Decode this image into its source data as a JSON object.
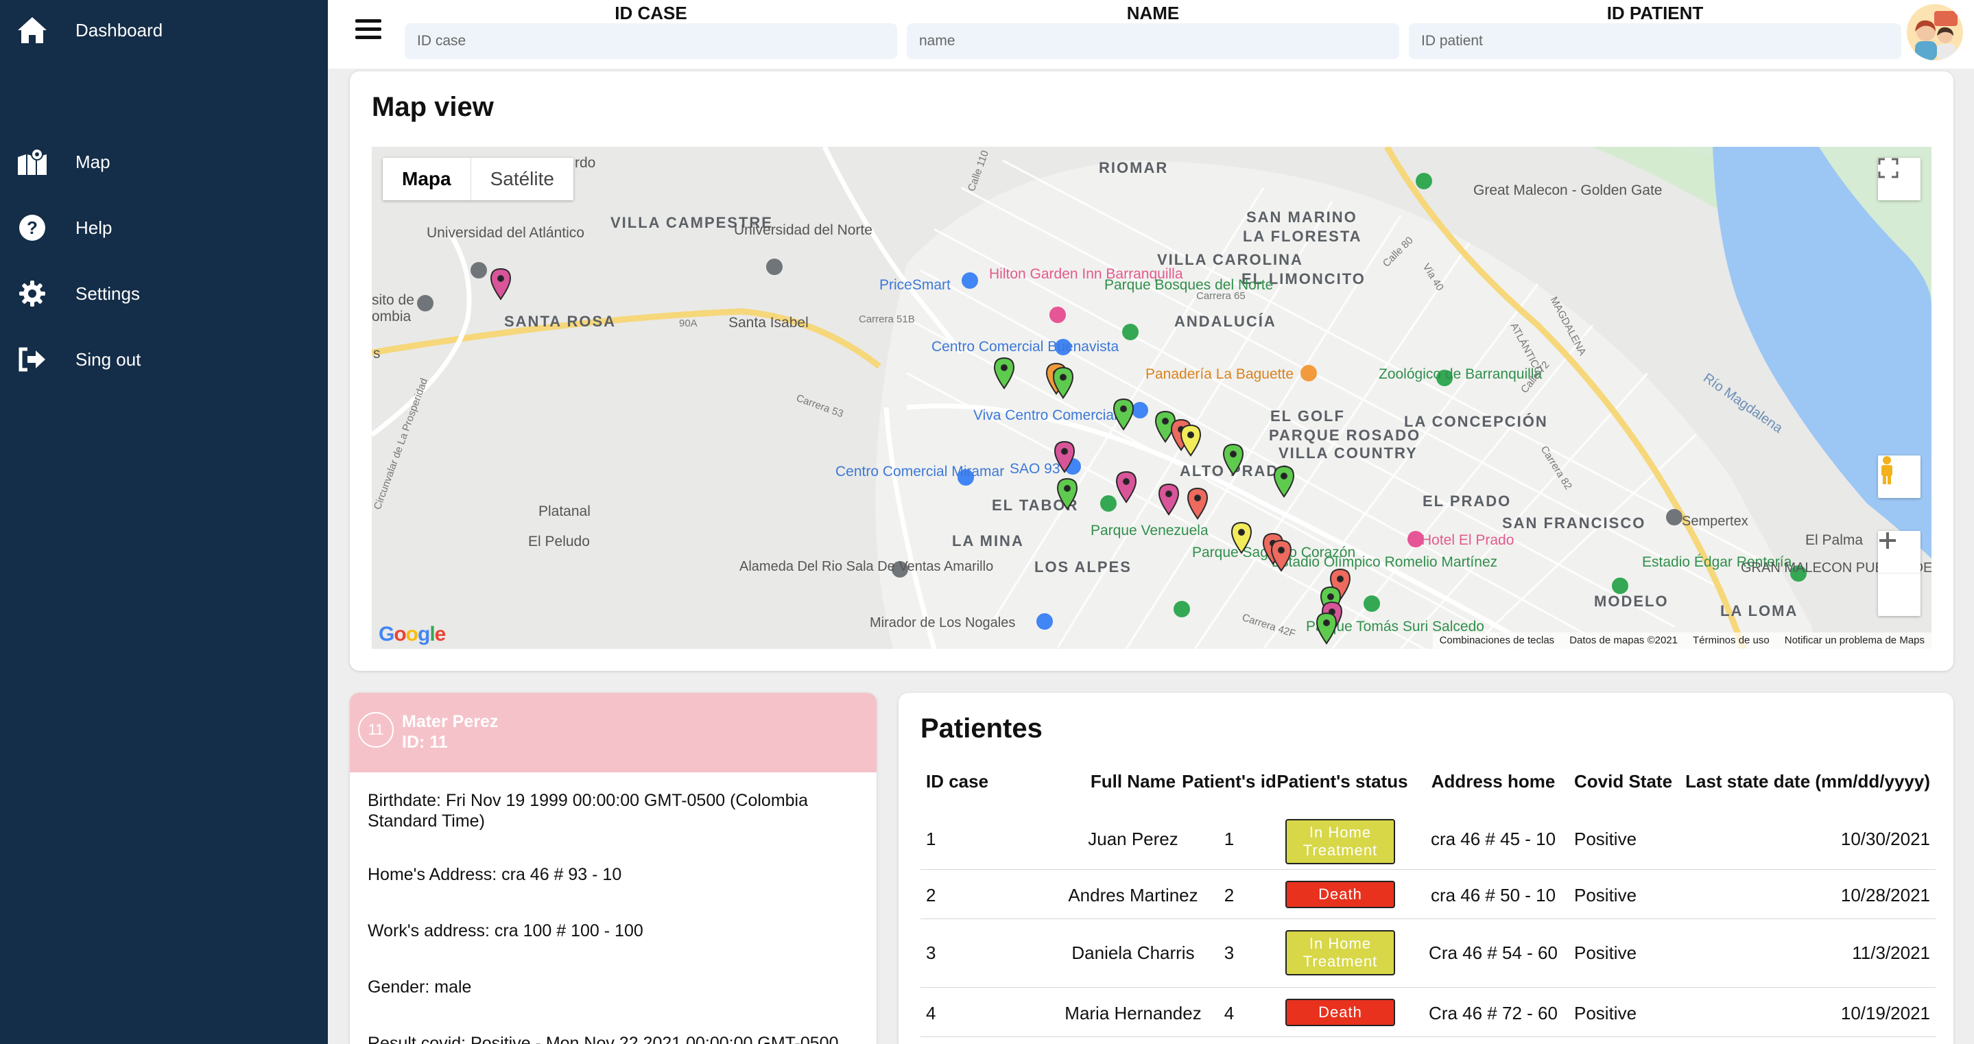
{
  "sidebar": {
    "items": [
      {
        "label": "Dashboard",
        "icon": "home-icon"
      },
      {
        "label": "Map",
        "icon": "map-icon"
      },
      {
        "label": "Help",
        "icon": "help-icon"
      },
      {
        "label": "Settings",
        "icon": "gear-icon"
      },
      {
        "label": "Sing out",
        "icon": "signout-icon"
      }
    ]
  },
  "header": {
    "search": [
      {
        "label": "ID CASE",
        "placeholder": "ID case"
      },
      {
        "label": "NAME",
        "placeholder": "name"
      },
      {
        "label": "ID PATIENT",
        "placeholder": "ID patient"
      }
    ]
  },
  "map": {
    "title": "Map view",
    "toggle": {
      "map": "Mapa",
      "satellite": "Satélite"
    },
    "labels": [
      "RIOMAR",
      "VILLA CAMPESTRE",
      "SANTA ROSA",
      "Santa Isabel",
      "SAN MARINO",
      "LA FLORESTA",
      "VILLA CAROLINA",
      "EL LIMONCITO",
      "ANDALUCÍA",
      "EL GOLF",
      "PARQUE ROSADO",
      "LA CONCEPCIÓN",
      "VILLA COUNTRY",
      "ALTO PRADO",
      "EL PRADO",
      "SAN FRANCISCO",
      "EL TABOR",
      "LA MINA",
      "LOS ALPES",
      "MODELO",
      "LA LOMA",
      "Platanal",
      "El Peludo",
      "El Palma",
      "Universidad del Atlántico",
      "Universidad del Norte",
      "Hilton Garden Inn Barranquilla",
      "PriceSmart",
      "Parque Bosques del Norte",
      "Centro Comercial Buenavista",
      "Viva Centro Comercial",
      "Panadería La Baguette",
      "Zoológico de Barranquilla",
      "Centro Comercial Miramar",
      "SAO 93",
      "Parque Venezuela",
      "Parque Sagrado Corazón",
      "Hotel El Prado",
      "Estadio Olímpico Romelio Martínez",
      "Sempertex",
      "Estadio Édgar Rentería",
      "GRAN MALECON PUERTA DE ORO",
      "Alameda Del Rio Sala De Ventas Amarillo",
      "Mirador de Los Nogales",
      "Parque Tomás Suri Salcedo",
      "Great Malecon - Golden Gate",
      "Río Magdalena",
      "Carrera 51B",
      "Carrera 65",
      "Calle 110",
      "Calle 80",
      "Vía 40",
      "Carrera 82",
      "Calle 72",
      "Carrera 42F",
      "Carrera 53",
      "MAGDALENA",
      "ATLÁNTICO",
      "90A",
      "Circunvalar de La Prosperidad",
      "sito de",
      "ombia",
      "rdo",
      "s"
    ],
    "google": "Google",
    "attribution": [
      "Combinaciones de teclas",
      "Datos de mapas ©2021",
      "Términos de uso",
      "Notificar un problema de Maps"
    ],
    "colors": {
      "green": "#5ecb4e",
      "pink": "#d9559a",
      "orange": "#f29b3c",
      "yellow": "#f3ec5a",
      "red": "#ee6a5e"
    }
  },
  "patient": {
    "badge": "11",
    "name": "Mater Perez",
    "id": "ID: 11",
    "birthdate": "Birthdate: Fri Nov 19 1999 00:00:00 GMT-0500 (Colombia Standard Time)",
    "home": "Home's Address: cra 46 # 93 - 10",
    "work": "Work's address: cra 100 # 100 - 100",
    "gender": "Gender: male",
    "result": "Result covid: Positive - Mon Nov 22 2021 00:00:00 GMT-0500"
  },
  "table": {
    "title": "Patientes",
    "headers": [
      "ID case",
      "Full Name",
      "Patient's id",
      "Patient's status",
      "Address home",
      "Covid State",
      "Last state date (mm/dd/yyyy)"
    ],
    "rows": [
      {
        "id": "1",
        "name": "Juan Perez",
        "pid": "1",
        "status": "In Home Treatment",
        "address": "cra 46 # 45 - 10",
        "covid": "Positive",
        "date": "10/30/2021"
      },
      {
        "id": "2",
        "name": "Andres Martinez",
        "pid": "2",
        "status": "Death",
        "address": "cra 46 # 50 - 10",
        "covid": "Positive",
        "date": "10/28/2021"
      },
      {
        "id": "3",
        "name": "Daniela Charris",
        "pid": "3",
        "status": "In Home Treatment",
        "address": "Cra 46 # 54 - 60",
        "covid": "Positive",
        "date": "11/3/2021"
      },
      {
        "id": "4",
        "name": "Maria Hernandez",
        "pid": "4",
        "status": "Death",
        "address": "Cra 46 # 72 - 60",
        "covid": "Positive",
        "date": "10/19/2021"
      }
    ],
    "status_colors": {
      "In Home Treatment": "#d7d748",
      "Death": "#e8321e"
    }
  }
}
